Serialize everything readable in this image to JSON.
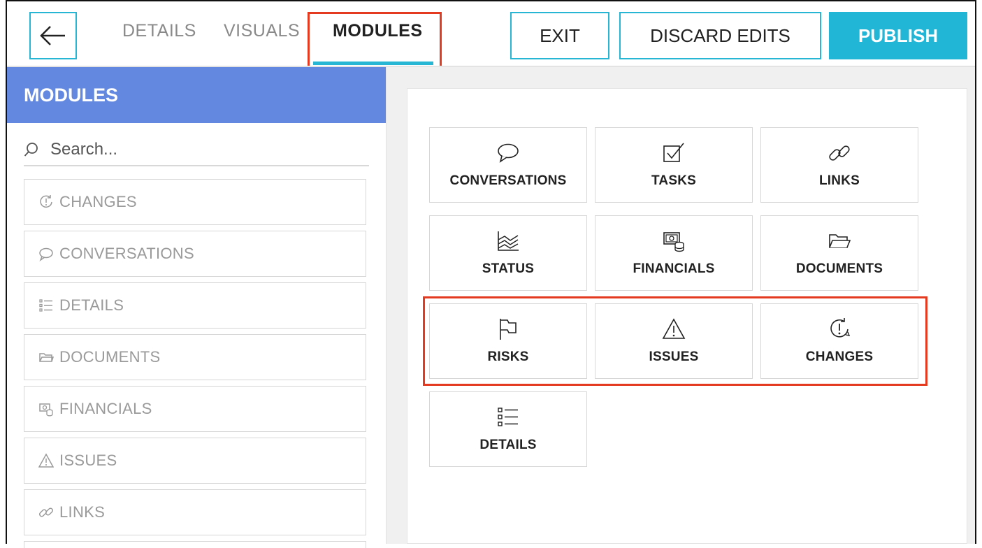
{
  "topbar": {
    "tabs": [
      {
        "label": "DETAILS"
      },
      {
        "label": "VISUALS"
      },
      {
        "label": "MODULES"
      }
    ],
    "exit_label": "EXIT",
    "discard_label": "DISCARD EDITS",
    "publish_label": "PUBLISH",
    "accent_color": "#21b5d6"
  },
  "sidebar": {
    "title": "MODULES",
    "header_color": "#6388df",
    "search_placeholder": "Search...",
    "items": [
      {
        "label": "CHANGES",
        "icon": "changes-icon"
      },
      {
        "label": "CONVERSATIONS",
        "icon": "speech-bubble-icon"
      },
      {
        "label": "DETAILS",
        "icon": "list-icon"
      },
      {
        "label": "DOCUMENTS",
        "icon": "folder-icon"
      },
      {
        "label": "FINANCIALS",
        "icon": "financials-icon"
      },
      {
        "label": "ISSUES",
        "icon": "warning-icon"
      },
      {
        "label": "LINKS",
        "icon": "link-icon"
      }
    ]
  },
  "grid": {
    "tiles": [
      {
        "label": "CONVERSATIONS",
        "icon": "speech-bubble-icon"
      },
      {
        "label": "TASKS",
        "icon": "checkbox-icon"
      },
      {
        "label": "LINKS",
        "icon": "link-icon"
      },
      {
        "label": "STATUS",
        "icon": "status-chart-icon"
      },
      {
        "label": "FINANCIALS",
        "icon": "financials-icon"
      },
      {
        "label": "DOCUMENTS",
        "icon": "folder-icon"
      },
      {
        "label": "RISKS",
        "icon": "flag-icon"
      },
      {
        "label": "ISSUES",
        "icon": "warning-icon"
      },
      {
        "label": "CHANGES",
        "icon": "changes-icon"
      },
      {
        "label": "DETAILS",
        "icon": "list-icon"
      }
    ]
  },
  "highlight_color": "#e43a1f"
}
